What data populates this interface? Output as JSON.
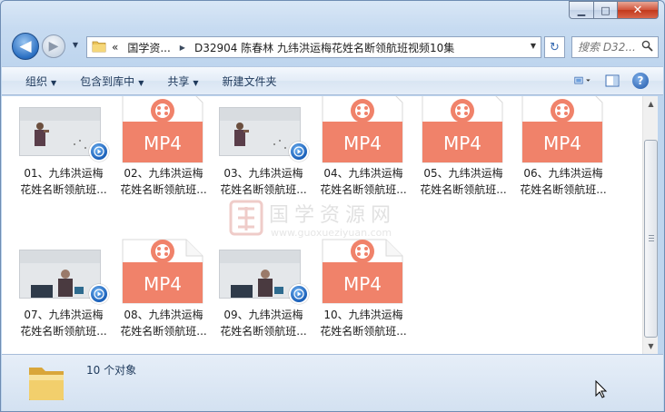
{
  "window": {
    "minimize_label": "▁",
    "maximize_label": "□",
    "close_label": "✕"
  },
  "nav": {
    "back_glyph": "◀",
    "forward_glyph": "▶",
    "recent_glyph": "▼",
    "address_prefix": "«",
    "breadcrumbs": [
      "国学资...",
      "D32904 陈春林 九纬洪运梅花姓名断领航班视频10集"
    ],
    "refresh_glyph": "↻",
    "search_placeholder": "搜索 D32...",
    "search_icon": "magnifier-icon"
  },
  "toolbar": {
    "items": [
      {
        "label": "组织",
        "has_dropdown": true
      },
      {
        "label": "包含到库中",
        "has_dropdown": true
      },
      {
        "label": "共享",
        "has_dropdown": true
      },
      {
        "label": "新建文件夹",
        "has_dropdown": false
      }
    ],
    "view_icon": "view-options-icon",
    "preview_icon": "preview-pane-icon",
    "help_label": "?"
  },
  "files": [
    {
      "type": "video",
      "line1": "01、九纬洪运梅",
      "line2": "花姓名断领航班..."
    },
    {
      "type": "mp4",
      "line1": "02、九纬洪运梅",
      "line2": "花姓名断领航班..."
    },
    {
      "type": "video",
      "line1": "03、九纬洪运梅",
      "line2": "花姓名断领航班..."
    },
    {
      "type": "mp4",
      "line1": "04、九纬洪运梅",
      "line2": "花姓名断领航班..."
    },
    {
      "type": "mp4",
      "line1": "05、九纬洪运梅",
      "line2": "花姓名断领航班..."
    },
    {
      "type": "mp4",
      "line1": "06、九纬洪运梅",
      "line2": "花姓名断领航班..."
    },
    {
      "type": "video",
      "line1": "07、九纬洪运梅",
      "line2": "花姓名断领航班..."
    },
    {
      "type": "mp4",
      "line1": "08、九纬洪运梅",
      "line2": "花姓名断领航班..."
    },
    {
      "type": "video",
      "line1": "09、九纬洪运梅",
      "line2": "花姓名断领航班..."
    },
    {
      "type": "mp4",
      "line1": "10、九纬洪运梅",
      "line2": "花姓名断领航班..."
    }
  ],
  "mp4_label": "MP4",
  "watermark": {
    "chinese": "国学资源网",
    "latin": "www.guoxueziyuan.com"
  },
  "status": {
    "count_text": "10 个对象"
  },
  "colors": {
    "mp4_orange": "#f0826a",
    "badge_blue": "#1a5fb8",
    "toolbar_text": "#1e395b"
  }
}
